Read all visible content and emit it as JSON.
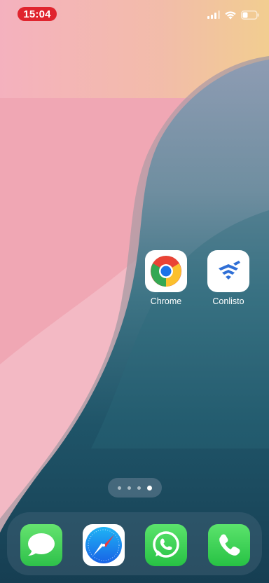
{
  "status_bar": {
    "time": "15:04",
    "time_pill_color": "#e0242e",
    "icons": [
      "cellular-signal-icon",
      "wifi-icon",
      "battery-icon"
    ]
  },
  "home_apps": [
    {
      "label": "Chrome",
      "icon": "chrome-icon"
    },
    {
      "label": "Conlisto",
      "icon": "conlisto-icon"
    }
  ],
  "page_indicator": {
    "page_count": 4,
    "active_page": 4
  },
  "dock": [
    {
      "app": "messages",
      "icon": "messages-icon"
    },
    {
      "app": "safari",
      "icon": "safari-icon"
    },
    {
      "app": "whatsapp",
      "icon": "whatsapp-icon"
    },
    {
      "app": "phone",
      "icon": "phone-icon"
    }
  ],
  "colors": {
    "accent_green": "#2ec14a",
    "conlisto_blue": "#2f6fd6"
  }
}
